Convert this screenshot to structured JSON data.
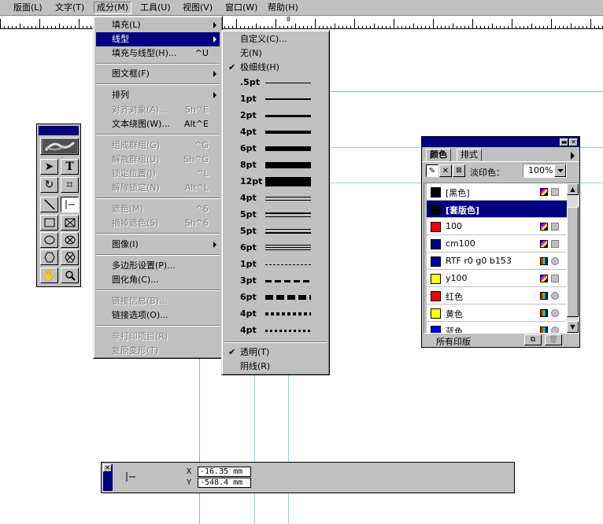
{
  "menubar": {
    "items": [
      {
        "label": "版面(L)"
      },
      {
        "label": "文字(T)"
      },
      {
        "label": "成分(M)"
      },
      {
        "label": "工具(U)"
      },
      {
        "label": "视图(V)"
      },
      {
        "label": "窗口(W)"
      },
      {
        "label": "帮助(H)"
      }
    ]
  },
  "ruler": {
    "labels": [
      "0"
    ]
  },
  "object_menu": {
    "items": [
      {
        "label": "填充(L)",
        "shortcut": ""
      },
      {
        "label": "线型",
        "shortcut": ""
      },
      {
        "label": "填充与线型(H)...",
        "shortcut": "^U"
      },
      {
        "label": "图文框(F)",
        "shortcut": ""
      },
      {
        "label": "排列",
        "shortcut": ""
      },
      {
        "label": "对齐对象(A)...",
        "shortcut": "Sh^E"
      },
      {
        "label": "文本绕图(W)...",
        "shortcut": "Alt^E"
      },
      {
        "label": "组成群组(G)",
        "shortcut": "^G"
      },
      {
        "label": "解散群组(U)",
        "shortcut": "Sh^G"
      },
      {
        "label": "锁定位置(J)",
        "shortcut": "^L"
      },
      {
        "label": "解除锁定(N)",
        "shortcut": "Alt^L"
      },
      {
        "label": "遮色(M)",
        "shortcut": "^6"
      },
      {
        "label": "摘掉遮色(S)",
        "shortcut": "Sh^6"
      },
      {
        "label": "图像(I)",
        "shortcut": ""
      },
      {
        "label": "多边形设置(P)...",
        "shortcut": ""
      },
      {
        "label": "圆化角(C)...",
        "shortcut": ""
      },
      {
        "label": "链接信息(B)...",
        "shortcut": ""
      },
      {
        "label": "链接选项(O)...",
        "shortcut": ""
      },
      {
        "label": "非打印项目(R)",
        "shortcut": ""
      },
      {
        "label": "复原变形(T)",
        "shortcut": ""
      }
    ]
  },
  "line_submenu": {
    "items": [
      {
        "label": "自定义(C)..."
      },
      {
        "label": "无(N)"
      },
      {
        "label": "极细线(H)"
      },
      {
        "label": ".5pt"
      },
      {
        "label": "1pt"
      },
      {
        "label": "2pt"
      },
      {
        "label": "4pt"
      },
      {
        "label": "6pt"
      },
      {
        "label": "8pt"
      },
      {
        "label": "12pt"
      },
      {
        "label": "4pt"
      },
      {
        "label": "5pt"
      },
      {
        "label": "5pt"
      },
      {
        "label": "6pt"
      },
      {
        "label": "1pt"
      },
      {
        "label": "3pt"
      },
      {
        "label": "6pt"
      },
      {
        "label": "4pt"
      },
      {
        "label": "4pt"
      },
      {
        "label": "透明(T)"
      },
      {
        "label": "阴线(R)"
      }
    ]
  },
  "tools": {
    "icons": [
      "pointer-icon",
      "text-icon",
      "rotate-icon",
      "crop-icon",
      "line-icon",
      "perpendicular-line-icon",
      "rectangle-icon",
      "rectangle-frame-icon",
      "ellipse-icon",
      "ellipse-frame-icon",
      "polygon-icon",
      "polygon-frame-icon",
      "hand-icon",
      "zoom-icon"
    ]
  },
  "color_panel": {
    "tabs": [
      {
        "label": "颜色"
      },
      {
        "label": "排式"
      }
    ],
    "tint_label": "淡印色：",
    "tint_value": "100%",
    "swatches": [
      {
        "name": "[黑色]",
        "color": "#000000"
      },
      {
        "name": "[套版色]",
        "color": "#000000"
      },
      {
        "name": "100",
        "color": "#ff0000"
      },
      {
        "name": "cm100",
        "color": "#000080"
      },
      {
        "name": "RTF r0 g0 b153",
        "color": "#000099"
      },
      {
        "name": "y100",
        "color": "#ffff00"
      },
      {
        "name": "红色",
        "color": "#ff0000"
      },
      {
        "name": "黄色",
        "color": "#ffff00"
      },
      {
        "name": "蓝色",
        "color": "#0000ff"
      }
    ],
    "footer_label": "所有印版"
  },
  "statusbar": {
    "x_label": "X",
    "y_label": "Y",
    "x_value": "-16.35 mm",
    "y_value": "-548.4 mm"
  }
}
